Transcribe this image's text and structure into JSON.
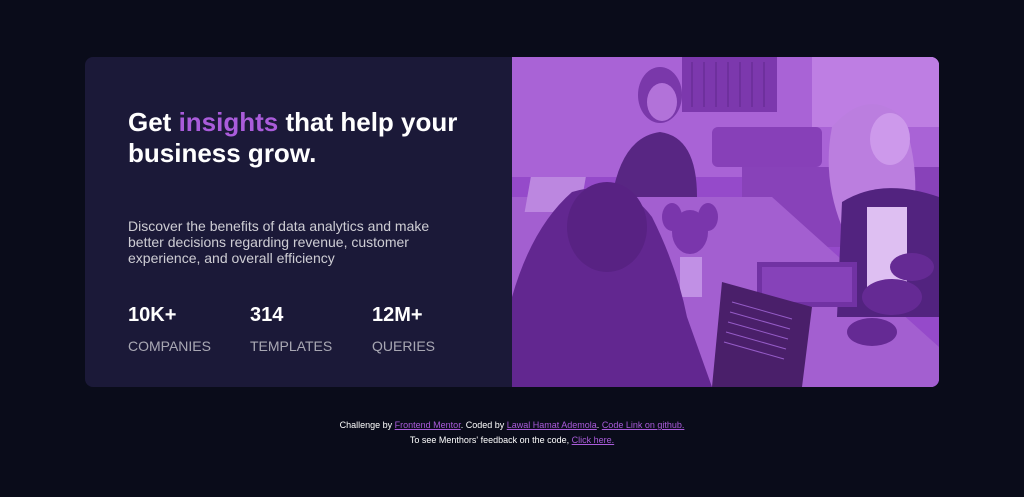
{
  "card": {
    "headline_start": "Get ",
    "headline_accent": "insights",
    "headline_end": " that help your business grow.",
    "description": "Discover the benefits of data analytics and make better decisions regarding revenue, customer experience, and overall efficiency",
    "stats": [
      {
        "value": "10K+",
        "label": "COMPANIES"
      },
      {
        "value": "314",
        "label": "TEMPLATES"
      },
      {
        "value": "12M+",
        "label": "QUERIES"
      }
    ],
    "image": {
      "subject": "people-working-on-laptops-photo",
      "tint_color": "#aa5cdb"
    }
  },
  "footer": {
    "challenge_by": "Challenge by ",
    "frontend_mentor_link": "Frontend Mentor",
    "coded_by": ". Coded by ",
    "author_link": "Lawal Hamat Ademola",
    "sep": ". ",
    "code_link": "Code Link on github.",
    "feedback_text": "To see Menthors' feedback on the code, ",
    "feedback_link": "Click here."
  },
  "colors": {
    "page_bg": "#0a0c1a",
    "card_bg": "#1b1938",
    "accent": "#aa5cdb"
  }
}
